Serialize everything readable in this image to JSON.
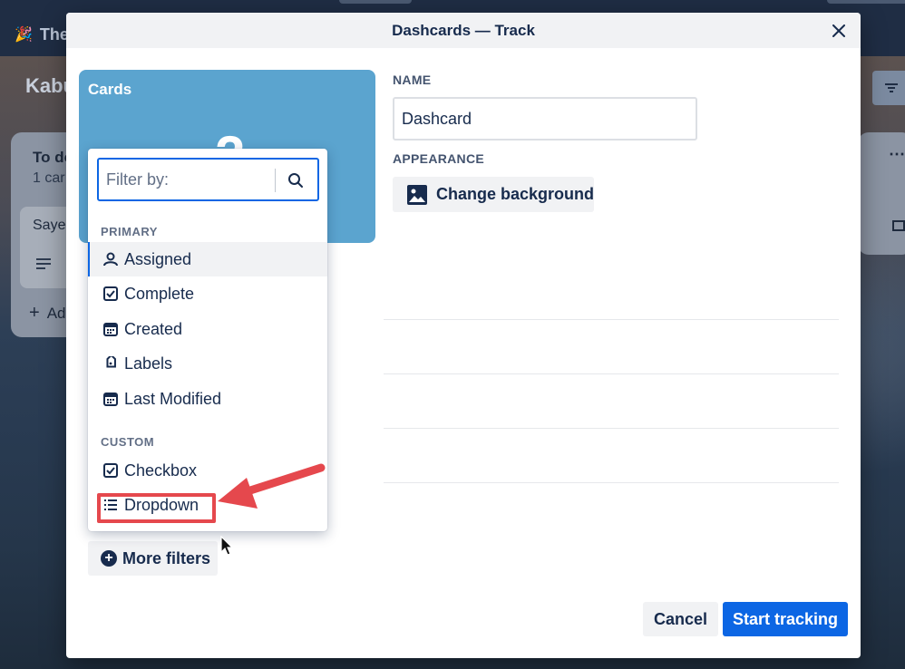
{
  "background": {
    "announcement_emoji": "🎉",
    "announcement_text": "The",
    "board_title": "Kabu",
    "list": {
      "title": "To do",
      "count": "1 car",
      "card_title": "Saye",
      "add_card": "Ad"
    },
    "filter_icon": "filter-icon",
    "right_list_menu": "⋯"
  },
  "modal": {
    "title": "Dashcards — Track",
    "close_icon": "close-icon",
    "preview": {
      "title": "Cards",
      "count": "2"
    },
    "name_label": "NAME",
    "name_value": "Dashcard",
    "appearance_label": "APPEARANCE",
    "change_background_label": "Change background",
    "more_filters_label": "More filters",
    "cancel_label": "Cancel",
    "start_label": "Start tracking"
  },
  "filter_popover": {
    "placeholder": "Filter by:",
    "primary_label": "PRIMARY",
    "primary_items": [
      {
        "label": "Assigned",
        "icon": "assignee-icon"
      },
      {
        "label": "Complete",
        "icon": "checkbox-icon"
      },
      {
        "label": "Created",
        "icon": "calendar-icon"
      },
      {
        "label": "Labels",
        "icon": "label-icon"
      },
      {
        "label": "Last Modified",
        "icon": "calendar-icon"
      }
    ],
    "custom_label": "CUSTOM",
    "custom_items": [
      {
        "label": "Checkbox",
        "icon": "checkbox-icon"
      },
      {
        "label": "Dropdown",
        "icon": "list-icon"
      }
    ]
  },
  "colors": {
    "primary_blue": "#0c66e4",
    "preview_blue": "#5ba4cf",
    "annotation_red": "#e5484d"
  }
}
